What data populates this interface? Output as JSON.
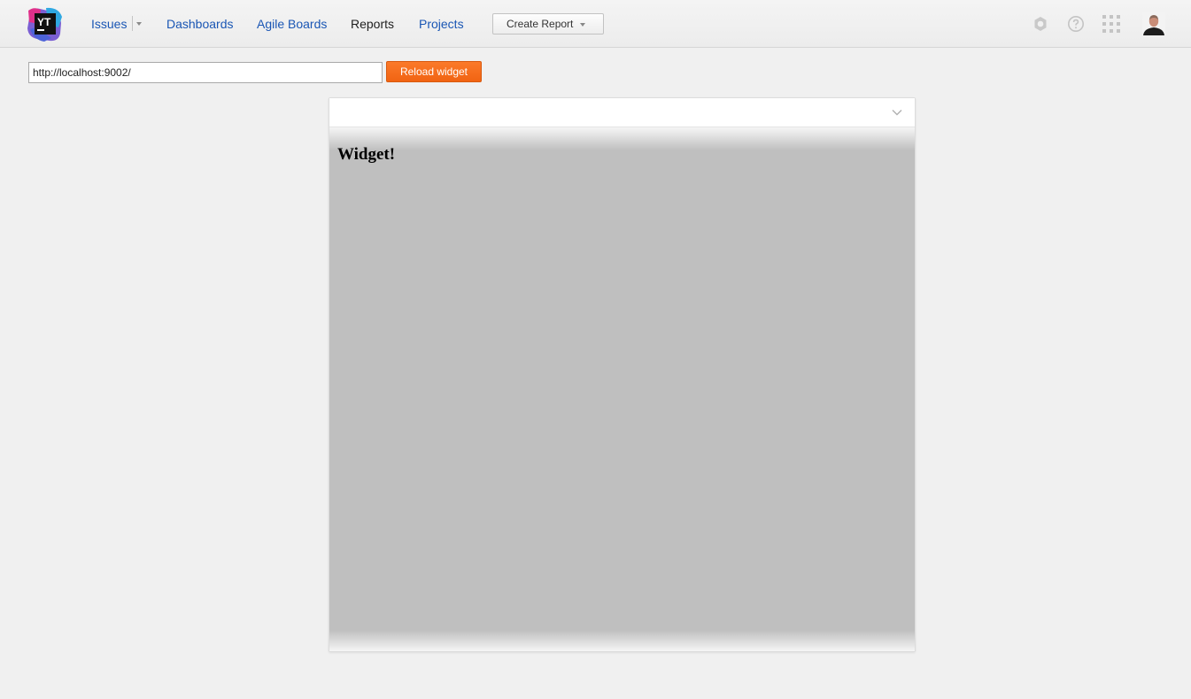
{
  "header": {
    "logo": {
      "text": "YT",
      "icon": "youtrack-logo"
    },
    "nav": [
      {
        "label": "Issues",
        "state": "link",
        "has_dropdown": true
      },
      {
        "label": "Dashboards",
        "state": "link"
      },
      {
        "label": "Agile Boards",
        "state": "link"
      },
      {
        "label": "Reports",
        "state": "active"
      },
      {
        "label": "Projects",
        "state": "link"
      }
    ],
    "create_report_label": "Create Report",
    "icons": [
      "settings-gear-icon",
      "help-icon",
      "apps-grid-icon",
      "user-avatar"
    ]
  },
  "toolbar": {
    "url_value": "http://localhost:9002/",
    "reload_label": "Reload widget"
  },
  "widget": {
    "heading": "Widget!"
  },
  "colors": {
    "link": "#1a56b4",
    "accent": "#f16412",
    "page_background": "#f0f0f0",
    "widget_content_background": "#bfbfbf"
  }
}
